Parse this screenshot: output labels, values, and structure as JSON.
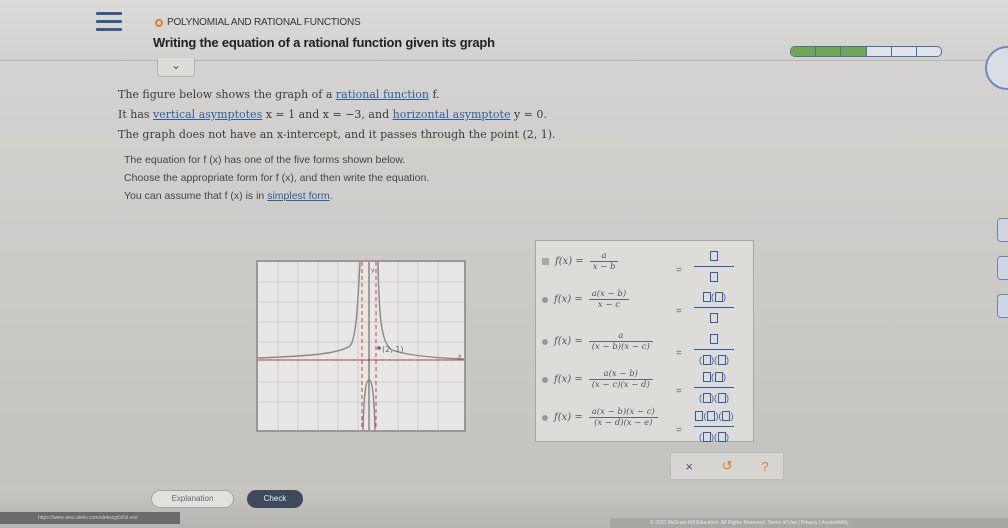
{
  "header": {
    "topic": "POLYNOMIAL AND RATIONAL FUNCTIONS",
    "title": "Writing the equation of a rational function given its graph",
    "progress_filled_fraction": 0.5
  },
  "problem": {
    "line1_pre": "The figure below shows the graph of a ",
    "line1_link": "rational function",
    "line1_post": " f.",
    "line2_pre": "It has ",
    "line2_link": "vertical asymptotes",
    "line2_mid": " x = 1 and x = −3, and ",
    "line2_link2": "horizontal asymptote",
    "line2_post": " y = 0.",
    "line3": "The graph does not have an x-intercept, and it passes through the point (2, 1)."
  },
  "instructions": {
    "line1": "The equation for f (x) has one of the five forms shown below.",
    "line2": "Choose the appropriate form for f (x), and then write the equation.",
    "line3_pre": "You can assume that f (x) is in ",
    "line3_link": "simplest form",
    "line3_post": "."
  },
  "graph": {
    "point_label": "(2, 1)"
  },
  "choices": [
    {
      "lhs": "f(x) =",
      "num": "a",
      "den": "x − b"
    },
    {
      "lhs": "f(x) =",
      "num": "a(x − b)",
      "den": "x − c"
    },
    {
      "lhs": "f(x) =",
      "num": "a",
      "den": "(x − b)(x − c)"
    },
    {
      "lhs": "f(x) =",
      "num": "a(x − b)",
      "den": "(x − c)(x − d)"
    },
    {
      "lhs": "f(x) =",
      "num": "a(x − b)(x − c)",
      "den": "(x − d)(x − e)"
    }
  ],
  "equals": "=",
  "actions": {
    "clear": "×",
    "undo": "↺",
    "help": "?"
  },
  "footer": {
    "explanation": "Explanation",
    "check": "Check",
    "url": "https://www-awu.aleks.com/alekscgi/x/Isl.exe",
    "copyright": "© 2020 McGraw-Hill Education. All Rights Reserved.   Terms of Use  |  Privacy  |  Accessibility"
  },
  "colors": {
    "accent": "#2f5d9e",
    "orange": "#e8792e",
    "progress": "#6fa650",
    "asymptote": "#d23b3b",
    "curve": "#8a8888"
  }
}
